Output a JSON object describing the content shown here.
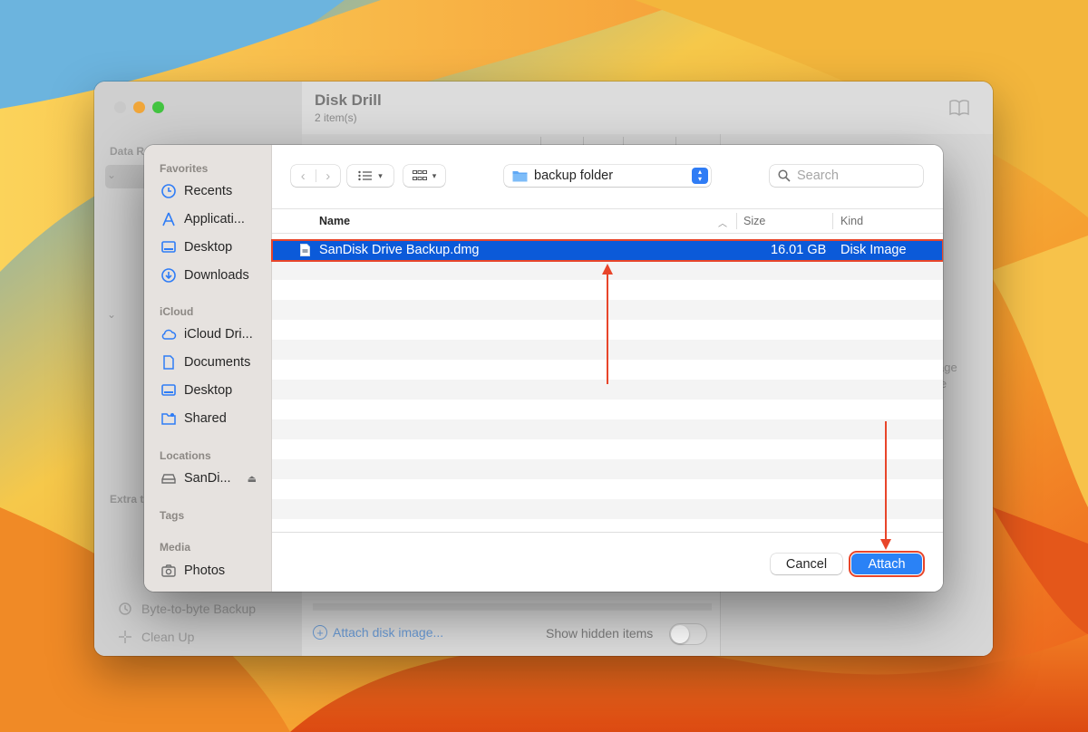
{
  "colors": {
    "accent": "#0b5ad9",
    "attach_button": "#2a82f6",
    "annotation": "#e8452a"
  },
  "app": {
    "title": "Disk Drill",
    "subtitle": "2 item(s)",
    "sidebar_section_1": "Data R",
    "sidebar_section_2": "Extra t",
    "tool_backup": "Byte-to-byte Backup",
    "tool_cleanup": "Clean Up",
    "right_hint_1": "age",
    "right_hint_2": "le",
    "attach_disk_image": "Attach disk image...",
    "show_hidden_items": "Show hidden items"
  },
  "dialog": {
    "sidebar": {
      "favorites_label": "Favorites",
      "favorites": [
        {
          "label": "Recents",
          "icon": "clock-icon"
        },
        {
          "label": "Applicati...",
          "icon": "applications-icon"
        },
        {
          "label": "Desktop",
          "icon": "desktop-icon"
        },
        {
          "label": "Downloads",
          "icon": "downloads-icon"
        }
      ],
      "icloud_label": "iCloud",
      "icloud": [
        {
          "label": "iCloud Dri...",
          "icon": "cloud-icon"
        },
        {
          "label": "Documents",
          "icon": "document-icon"
        },
        {
          "label": "Desktop",
          "icon": "desktop-icon"
        },
        {
          "label": "Shared",
          "icon": "shared-folder-icon"
        }
      ],
      "locations_label": "Locations",
      "locations": [
        {
          "label": "SanDi...",
          "icon": "drive-icon"
        }
      ],
      "tags_label": "Tags",
      "media_label": "Media",
      "media": [
        {
          "label": "Photos",
          "icon": "camera-icon"
        }
      ]
    },
    "toolbar": {
      "path_label": "backup folder",
      "search_placeholder": "Search"
    },
    "columns": {
      "name": "Name",
      "size": "Size",
      "kind": "Kind"
    },
    "file": {
      "name": "SanDisk Drive Backup.dmg",
      "size": "16.01 GB",
      "kind": "Disk Image"
    },
    "buttons": {
      "cancel": "Cancel",
      "attach": "Attach"
    }
  }
}
